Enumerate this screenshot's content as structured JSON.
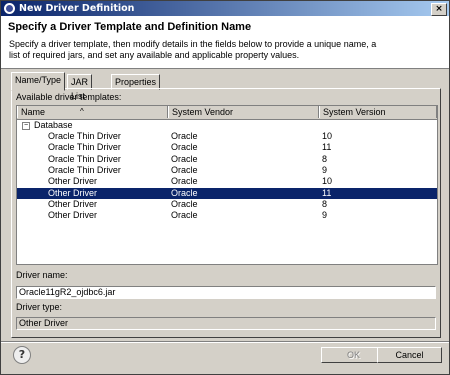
{
  "window": {
    "title": "New Driver Definition"
  },
  "header": {
    "title": "Specify a Driver Template and Definition Name",
    "description": "Specify a driver template, then modify details in the fields below to provide a unique name, a list of required jars, and set any available and applicable property values."
  },
  "tabs": [
    "Name/Type",
    "JAR List",
    "Properties"
  ],
  "templates": {
    "label": "Available driver templates:",
    "columns": [
      "Name",
      "System Vendor",
      "System Version"
    ],
    "sort_indicator": "^",
    "category": "Database",
    "rows": [
      {
        "name": "Oracle Thin Driver",
        "vendor": "Oracle",
        "version": "10"
      },
      {
        "name": "Oracle Thin Driver",
        "vendor": "Oracle",
        "version": "11"
      },
      {
        "name": "Oracle Thin Driver",
        "vendor": "Oracle",
        "version": "8"
      },
      {
        "name": "Oracle Thin Driver",
        "vendor": "Oracle",
        "version": "9"
      },
      {
        "name": "Other Driver",
        "vendor": "Oracle",
        "version": "10"
      },
      {
        "name": "Other Driver",
        "vendor": "Oracle",
        "version": "11"
      },
      {
        "name": "Other Driver",
        "vendor": "Oracle",
        "version": "8"
      },
      {
        "name": "Other Driver",
        "vendor": "Oracle",
        "version": "9"
      }
    ],
    "selected_index": 5
  },
  "driver_name": {
    "label": "Driver name:",
    "value": "Oracle11gR2_ojdbc6.jar"
  },
  "driver_type": {
    "label": "Driver type:",
    "value": "Other Driver"
  },
  "buttons": {
    "ok": "OK",
    "cancel": "Cancel",
    "help": "?"
  },
  "colors": {
    "selection": "#0a246a",
    "title_bar": "#0a246a",
    "face": "#d4d0c8"
  }
}
